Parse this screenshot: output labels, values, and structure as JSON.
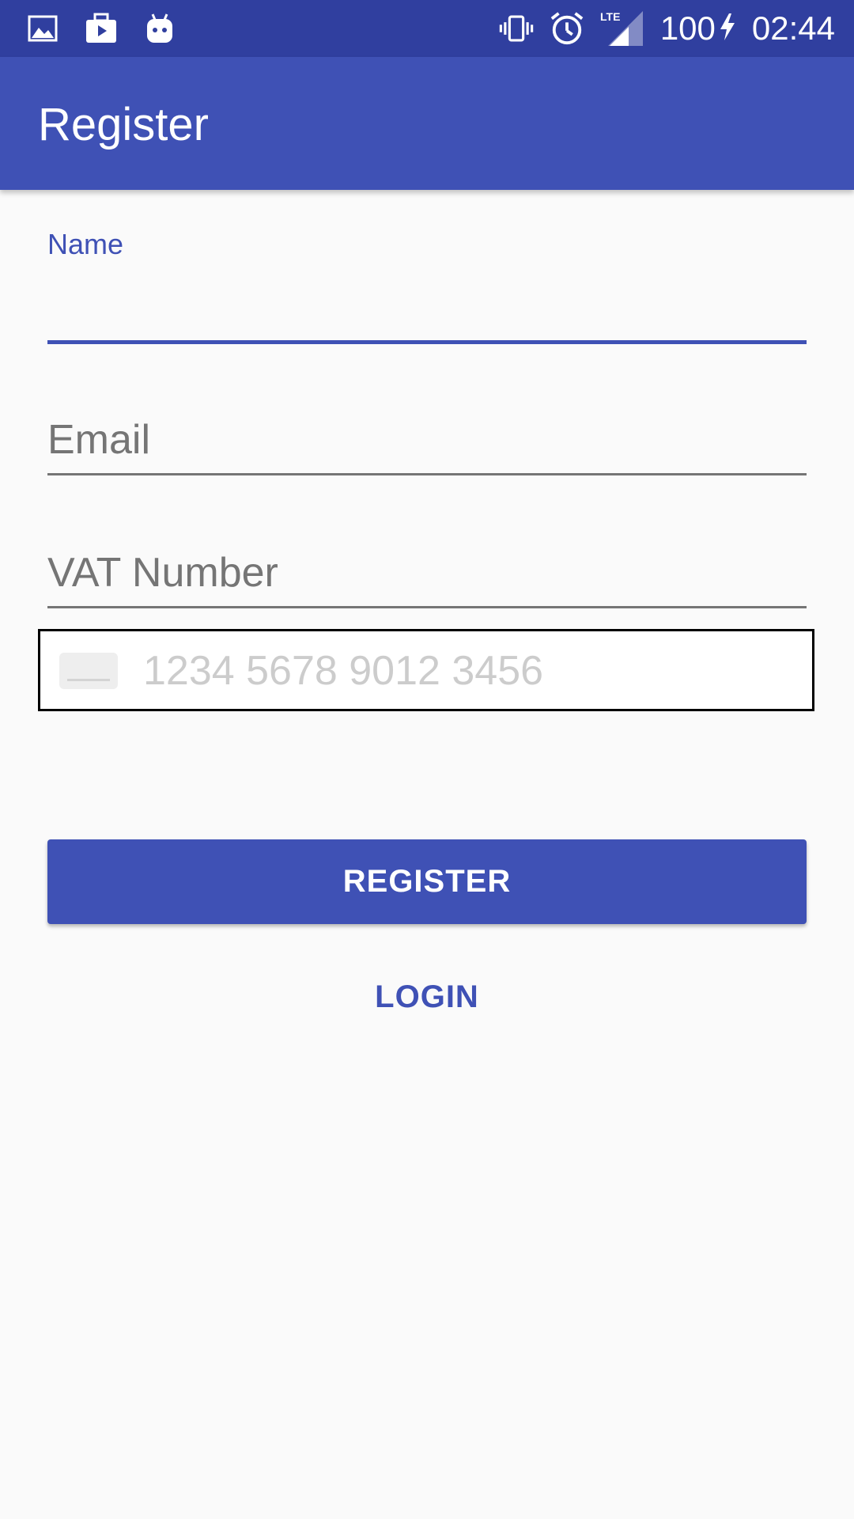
{
  "status_bar": {
    "battery_level": "100",
    "time": "02:44",
    "network_type": "LTE",
    "left_icons": [
      "image-icon",
      "media-store-icon",
      "android-icon"
    ],
    "right_icons": [
      "vibrate-icon",
      "alarm-icon",
      "lte-signal-icon",
      "charging-icon"
    ]
  },
  "app_bar": {
    "title": "Register"
  },
  "form": {
    "name": {
      "label": "Name",
      "value": ""
    },
    "email": {
      "placeholder": "Email",
      "value": ""
    },
    "vat": {
      "placeholder": "VAT Number",
      "value": ""
    },
    "card": {
      "placeholder": "1234 5678 9012 3456",
      "value": "",
      "icon": "credit-card-icon"
    }
  },
  "actions": {
    "register_label": "REGISTER",
    "login_label": "LOGIN"
  },
  "colors": {
    "primary": "#3f51b5",
    "primary_dark": "#303f9f",
    "background": "#fafafa",
    "hint": "#757575"
  }
}
